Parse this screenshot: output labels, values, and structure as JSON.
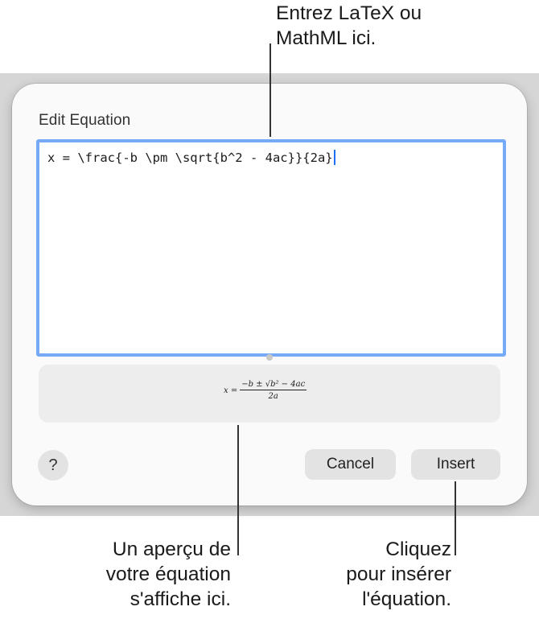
{
  "dialog": {
    "title": "Edit Equation",
    "latex_value": "x = \\frac{-b \\pm \\sqrt{b^2 - 4ac}}{2a}",
    "preview": {
      "lhs": "x =",
      "numerator": "−b ± √b² − 4ac",
      "denominator": "2a"
    },
    "buttons": {
      "help": "?",
      "cancel": "Cancel",
      "insert": "Insert"
    }
  },
  "callouts": {
    "editor": [
      "Entrez LaTeX ou",
      "MathML ici."
    ],
    "preview": [
      "Un aperçu de",
      "votre équation",
      "s'affiche ici."
    ],
    "insert": [
      "Cliquez",
      "pour insérer",
      "l'équation."
    ]
  },
  "colors": {
    "accent_border": "#76a9f7",
    "caret": "#1f6ff0",
    "backdrop": "#d6d6d6",
    "dialog_bg": "#fafafa"
  },
  "icons": {
    "help": "question-mark-icon",
    "caret": "text-caret",
    "resize": "resize-handle-dot"
  }
}
